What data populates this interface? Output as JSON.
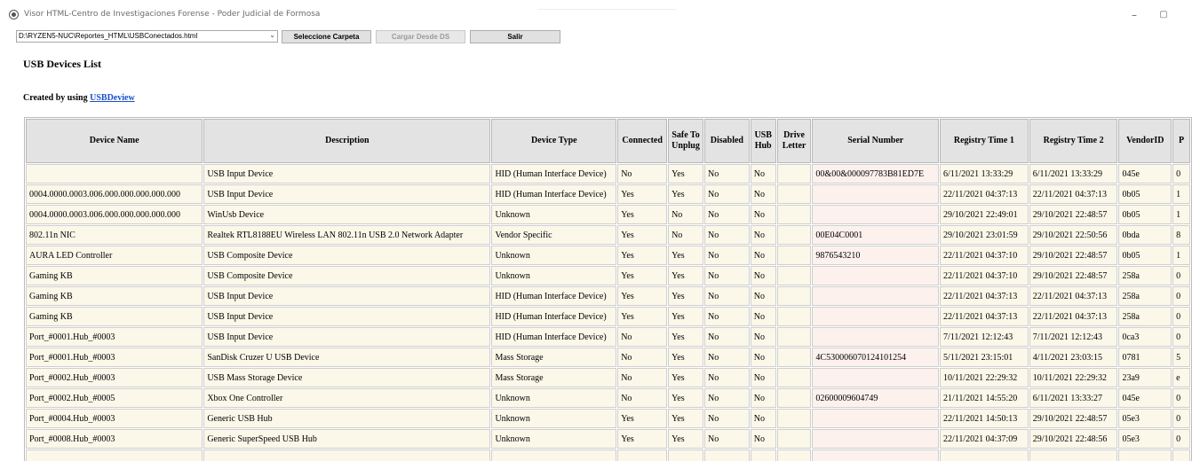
{
  "window": {
    "title": "Visor HTML-Centro de Investigaciones Forense - Poder Judicial de Formosa",
    "minimize_glyph": "–",
    "maximize_glyph": "▢"
  },
  "toolbar": {
    "path_value": "D:\\RYZEN5-NUC\\Reportes_HTML\\USBConectados.html",
    "select_folder_label": "Seleccione Carpeta",
    "load_ds_label": "Cargar Desde DS",
    "exit_label": "Salir"
  },
  "report": {
    "title": "USB Devices List",
    "created_prefix": "Created by using",
    "created_link": "USBDeview"
  },
  "table": {
    "headers": [
      "Device Name",
      "Description",
      "Device Type",
      "Connected",
      "Safe To Unplug",
      "Disabled",
      "USB Hub",
      "Drive Letter",
      "Serial Number",
      "Registry Time 1",
      "Registry Time 2",
      "VendorID",
      "P"
    ],
    "rows": [
      [
        "",
        "USB Input Device",
        "HID (Human Interface Device)",
        "No",
        "Yes",
        "No",
        "No",
        "",
        "00&00&000097783B81ED7E",
        "6/11/2021 13:33:29",
        "6/11/2021 13:33:29",
        "045e",
        "0"
      ],
      [
        "0004.0000.0003.006.000.000.000.000.000",
        "USB Input Device",
        "HID (Human Interface Device)",
        "Yes",
        "Yes",
        "No",
        "No",
        "",
        "",
        "22/11/2021 04:37:13",
        "22/11/2021 04:37:13",
        "0b05",
        "1"
      ],
      [
        "0004.0000.0003.006.000.000.000.000.000",
        "WinUsb Device",
        "Unknown",
        "Yes",
        "No",
        "No",
        "No",
        "",
        "",
        "29/10/2021 22:49:01",
        "29/10/2021 22:48:57",
        "0b05",
        "1"
      ],
      [
        "802.11n NIC",
        "Realtek RTL8188EU Wireless LAN 802.11n USB 2.0 Network Adapter",
        "Vendor Specific",
        "Yes",
        "No",
        "No",
        "No",
        "",
        "00E04C0001",
        "29/10/2021 23:01:59",
        "29/10/2021 22:50:56",
        "0bda",
        "8"
      ],
      [
        "AURA LED Controller",
        "USB Composite Device",
        "Unknown",
        "Yes",
        "Yes",
        "No",
        "No",
        "",
        "9876543210",
        "22/11/2021 04:37:10",
        "29/10/2021 22:48:57",
        "0b05",
        "1"
      ],
      [
        "Gaming KB",
        "USB Composite Device",
        "Unknown",
        "Yes",
        "Yes",
        "No",
        "No",
        "",
        "",
        "22/11/2021 04:37:10",
        "29/10/2021 22:48:57",
        "258a",
        "0"
      ],
      [
        "Gaming KB",
        "USB Input Device",
        "HID (Human Interface Device)",
        "Yes",
        "Yes",
        "No",
        "No",
        "",
        "",
        "22/11/2021 04:37:13",
        "22/11/2021 04:37:13",
        "258a",
        "0"
      ],
      [
        "Gaming KB",
        "USB Input Device",
        "HID (Human Interface Device)",
        "Yes",
        "Yes",
        "No",
        "No",
        "",
        "",
        "22/11/2021 04:37:13",
        "22/11/2021 04:37:13",
        "258a",
        "0"
      ],
      [
        "Port_#0001.Hub_#0003",
        "USB Input Device",
        "HID (Human Interface Device)",
        "No",
        "Yes",
        "No",
        "No",
        "",
        "",
        "7/11/2021 12:12:43",
        "7/11/2021 12:12:43",
        "0ca3",
        "0"
      ],
      [
        "Port_#0001.Hub_#0003",
        "SanDisk Cruzer U USB Device",
        "Mass Storage",
        "No",
        "Yes",
        "No",
        "No",
        "",
        "4C530006070124101254",
        "5/11/2021 23:15:01",
        "4/11/2021 23:03:15",
        "0781",
        "5"
      ],
      [
        "Port_#0002.Hub_#0003",
        "USB Mass Storage Device",
        "Mass Storage",
        "No",
        "Yes",
        "No",
        "No",
        "",
        "",
        "10/11/2021 22:29:32",
        "10/11/2021 22:29:32",
        "23a9",
        "e"
      ],
      [
        "Port_#0002.Hub_#0005",
        "Xbox One Controller",
        "Unknown",
        "No",
        "Yes",
        "No",
        "No",
        "",
        "02600009604749",
        "21/11/2021 14:55:20",
        "6/11/2021 13:33:27",
        "045e",
        "0"
      ],
      [
        "Port_#0004.Hub_#0003",
        "Generic USB Hub",
        "Unknown",
        "Yes",
        "Yes",
        "No",
        "No",
        "",
        "",
        "22/11/2021 14:50:13",
        "29/10/2021 22:48:57",
        "05e3",
        "0"
      ],
      [
        "Port_#0008.Hub_#0003",
        "Generic SuperSpeed USB Hub",
        "Unknown",
        "Yes",
        "Yes",
        "No",
        "No",
        "",
        "",
        "22/11/2021 04:37:09",
        "29/10/2021 22:48:56",
        "05e3",
        "0"
      ],
      [
        "",
        "",
        "",
        "",
        "",
        "",
        "",
        "",
        "",
        "",
        "",
        "",
        ""
      ]
    ]
  }
}
